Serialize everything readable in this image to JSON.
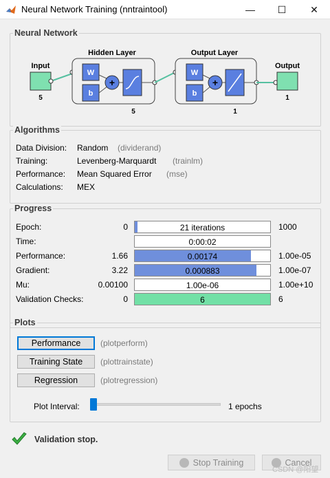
{
  "window": {
    "title": "Neural Network Training (nntraintool)",
    "minimize_glyph": "—",
    "maximize_glyph": "☐",
    "close_glyph": "✕"
  },
  "network": {
    "panel_title": "Neural Network",
    "input_label": "Input",
    "input_count": "5",
    "hidden_title": "Hidden Layer",
    "hidden_count": "5",
    "output_layer_title": "Output Layer",
    "output_layer_count": "1",
    "output_label": "Output",
    "output_count": "1",
    "weight_label": "W",
    "bias_label": "b",
    "sum_glyph": "+"
  },
  "algorithms": {
    "panel_title": "Algorithms",
    "rows": [
      {
        "label": "Data Division:",
        "value": "Random",
        "code": "(dividerand)"
      },
      {
        "label": "Training:",
        "value": "Levenberg-Marquardt",
        "code": "(trainlm)"
      },
      {
        "label": "Performance:",
        "value": "Mean Squared Error",
        "code": "(mse)"
      },
      {
        "label": "Calculations:",
        "value": "MEX",
        "code": ""
      }
    ]
  },
  "progress": {
    "panel_title": "Progress",
    "rows": [
      {
        "label": "Epoch:",
        "left": "0",
        "bar_text": "21 iterations",
        "right": "1000",
        "fill": 0.02,
        "fill_color": "#6f8fdc"
      },
      {
        "label": "Time:",
        "left": "",
        "bar_text": "0:00:02",
        "right": "",
        "fill": 0,
        "fill_color": "#6f8fdc"
      },
      {
        "label": "Performance:",
        "left": "1.66",
        "bar_text": "0.00174",
        "right": "1.00e-05",
        "fill": 0.86,
        "fill_color": "#6f8fdc"
      },
      {
        "label": "Gradient:",
        "left": "3.22",
        "bar_text": "0.000883",
        "right": "1.00e-07",
        "fill": 0.9,
        "fill_color": "#6f8fdc"
      },
      {
        "label": "Mu:",
        "left": "0.00100",
        "bar_text": "1.00e-06",
        "right": "1.00e+10",
        "fill": 0,
        "fill_color": "#6f8fdc"
      },
      {
        "label": "Validation Checks:",
        "left": "0",
        "bar_text": "6",
        "right": "6",
        "fill": 1.0,
        "fill_color": "#72e0a6"
      }
    ]
  },
  "plots": {
    "panel_title": "Plots",
    "buttons": [
      {
        "label": "Performance",
        "code": "(plotperform)"
      },
      {
        "label": "Training State",
        "code": "(plottrainstate)"
      },
      {
        "label": "Regression",
        "code": "(plotregression)"
      }
    ],
    "interval_label": "Plot Interval:",
    "interval_value": "1 epochs",
    "slider_level": 0.0
  },
  "status": {
    "message": "Validation stop.",
    "icon": "checkmark-icon"
  },
  "footer": {
    "stop_label": "Stop Training",
    "cancel_label": "Cancel",
    "watermark": "CSDN @阳望"
  },
  "colors": {
    "node_green": "#7fe0b0",
    "weight_blue": "#5a7fe0",
    "check_green": "#3cb043"
  }
}
